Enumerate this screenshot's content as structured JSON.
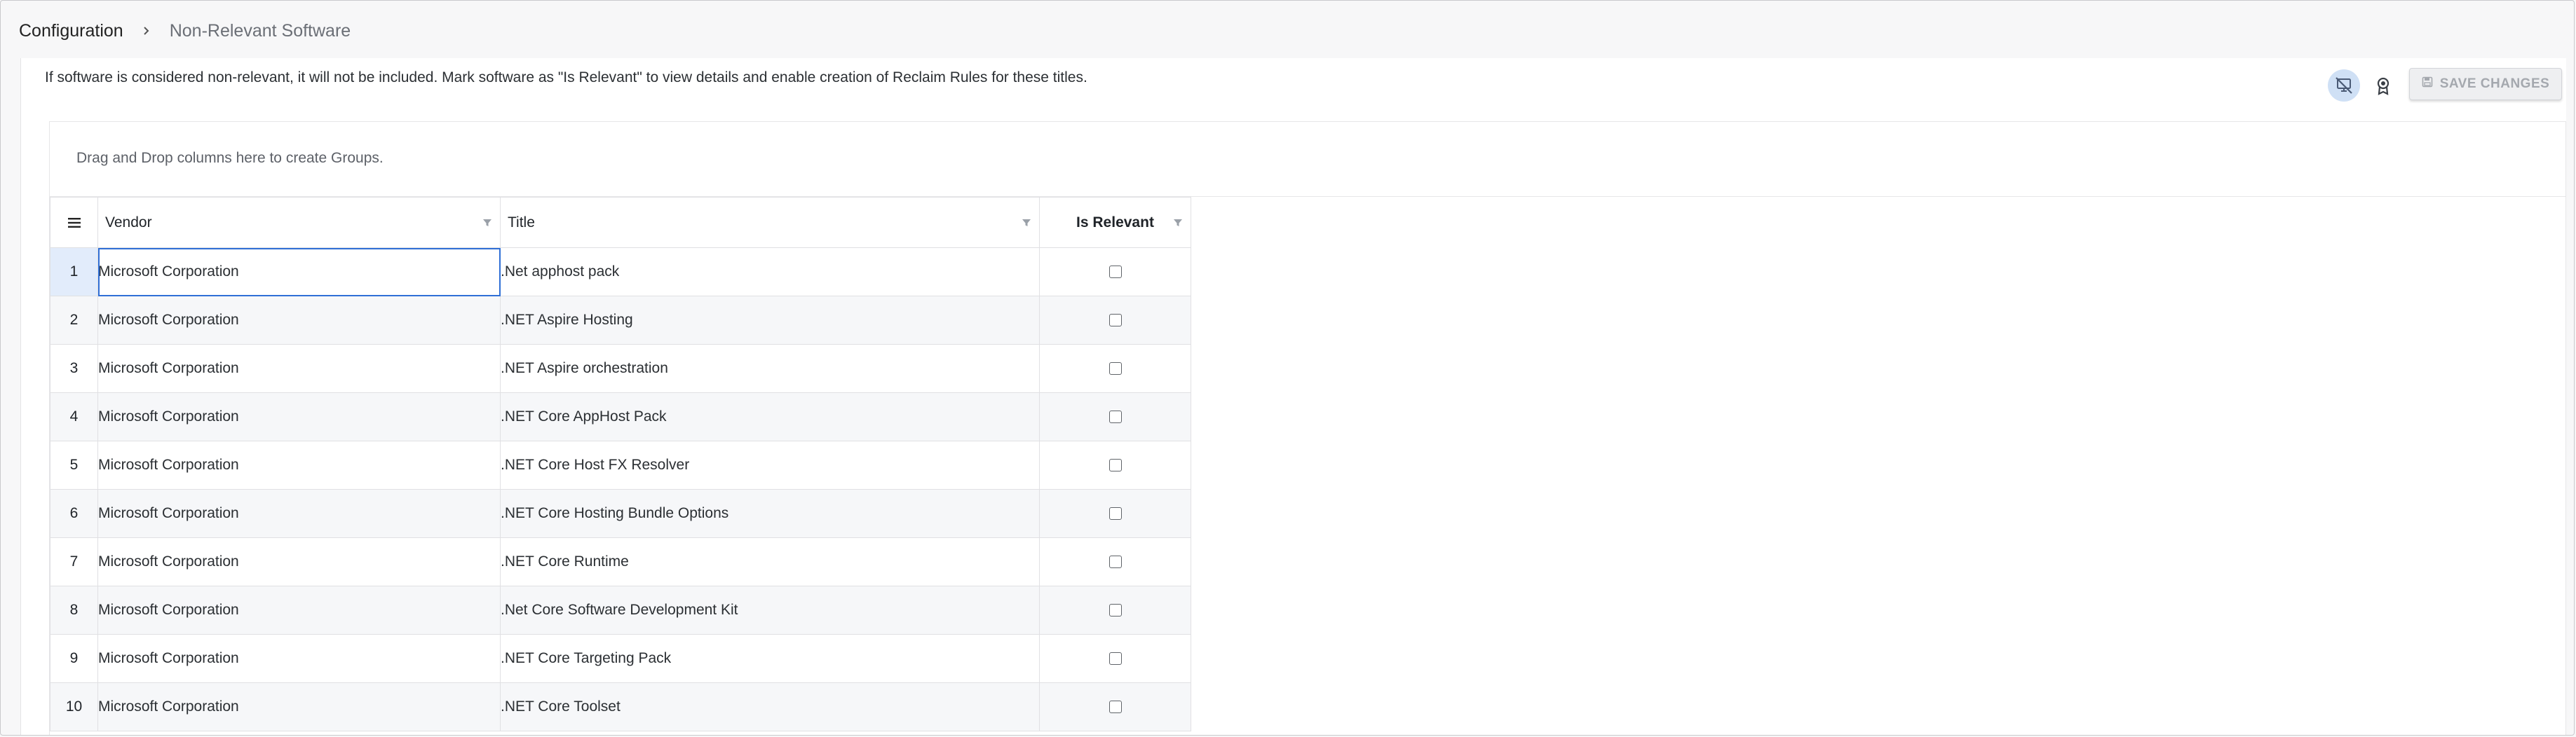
{
  "breadcrumb": {
    "root": "Configuration",
    "current": "Non-Relevant Software"
  },
  "info": {
    "text": "If software is considered non-relevant, it will not be included. Mark software as \"Is Relevant\" to view details and enable creation of Reclaim Rules for these titles."
  },
  "toolbar": {
    "save_label": "SAVE CHANGES",
    "hide_icon": "hide-irrelevant-icon",
    "ribbon_icon": "ribbon-icon",
    "save_icon": "floppy-disk-icon"
  },
  "grid": {
    "group_hint": "Drag and Drop columns here to create Groups.",
    "columns": {
      "vendor": "Vendor",
      "title": "Title",
      "is_relevant": "Is Relevant"
    },
    "rows": [
      {
        "num": "1",
        "vendor": "Microsoft Corporation",
        "title": ".Net apphost pack",
        "is_relevant": false
      },
      {
        "num": "2",
        "vendor": "Microsoft Corporation",
        "title": ".NET Aspire Hosting",
        "is_relevant": false
      },
      {
        "num": "3",
        "vendor": "Microsoft Corporation",
        "title": ".NET Aspire orchestration",
        "is_relevant": false
      },
      {
        "num": "4",
        "vendor": "Microsoft Corporation",
        "title": ".NET Core AppHost Pack",
        "is_relevant": false
      },
      {
        "num": "5",
        "vendor": "Microsoft Corporation",
        "title": ".NET Core Host FX Resolver",
        "is_relevant": false
      },
      {
        "num": "6",
        "vendor": "Microsoft Corporation",
        "title": ".NET Core Hosting Bundle Options",
        "is_relevant": false
      },
      {
        "num": "7",
        "vendor": "Microsoft Corporation",
        "title": ".NET Core Runtime",
        "is_relevant": false
      },
      {
        "num": "8",
        "vendor": "Microsoft Corporation",
        "title": ".Net Core Software Development Kit",
        "is_relevant": false
      },
      {
        "num": "9",
        "vendor": "Microsoft Corporation",
        "title": ".NET Core Targeting Pack",
        "is_relevant": false
      },
      {
        "num": "10",
        "vendor": "Microsoft Corporation",
        "title": ".NET Core Toolset",
        "is_relevant": false
      }
    ]
  },
  "colors": {
    "accent": "#2f6fd6",
    "selected_header": "#e2ecfb",
    "stripe": "#f6f7f9"
  }
}
